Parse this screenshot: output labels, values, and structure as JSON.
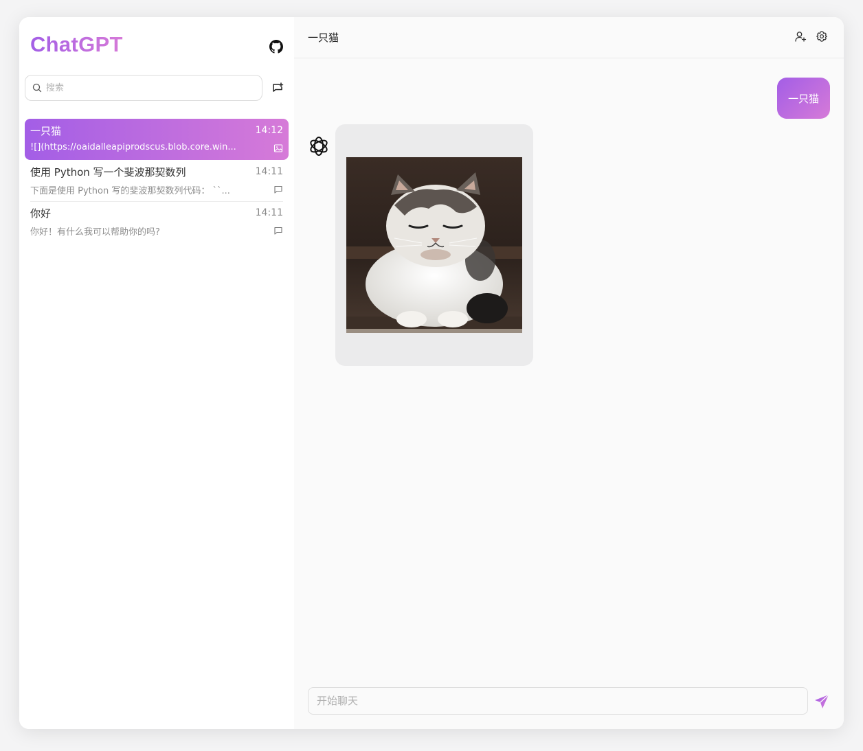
{
  "app": {
    "brand": "ChatGPT"
  },
  "sidebar": {
    "search_placeholder": "搜索",
    "items": [
      {
        "title": "一只猫",
        "time": "14:12",
        "preview": "![](https://oaidalleapiprodscus.blob.core.win...",
        "icon": "image-icon",
        "active": true
      },
      {
        "title": "使用 Python 写一个斐波那契数列",
        "time": "14:11",
        "preview": "下面是使用 Python 写的斐波那契数列代码： ``...",
        "icon": "message-icon",
        "active": false
      },
      {
        "title": "你好",
        "time": "14:11",
        "preview": "你好！有什么我可以帮助你的吗?",
        "icon": "message-icon",
        "active": false
      }
    ]
  },
  "main": {
    "title": "一只猫",
    "messages": [
      {
        "role": "user",
        "text": "一只猫"
      },
      {
        "role": "assistant",
        "content": "image"
      }
    ],
    "composer_placeholder": "开始聊天"
  },
  "colors": {
    "accent_start": "#a35ee6",
    "accent_end": "#d67ad8"
  }
}
